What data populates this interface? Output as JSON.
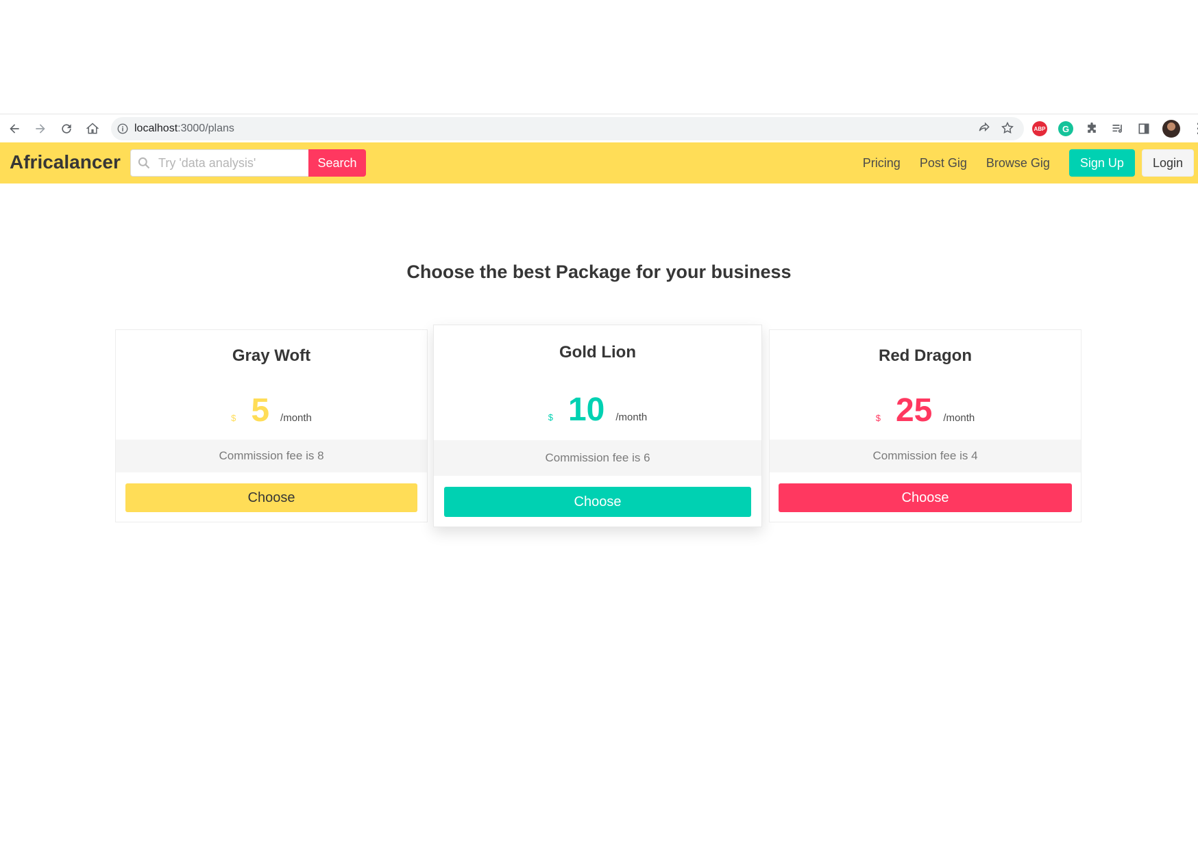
{
  "browser": {
    "url_host": "localhost",
    "url_path": ":3000/plans",
    "extensions": [
      "ABP",
      "G"
    ]
  },
  "navbar": {
    "brand": "Africalancer",
    "search_placeholder": "Try 'data analysis'",
    "search_button": "Search",
    "links": [
      "Pricing",
      "Post Gig",
      "Browse Gig"
    ],
    "signup": "Sign Up",
    "login": "Login"
  },
  "page": {
    "heading": "Choose the best Package for your business"
  },
  "plans": [
    {
      "name": "Gray Woft",
      "currency": "$",
      "amount": "5",
      "period": "/month",
      "commission": "Commission fee is 8",
      "button": "Choose",
      "color": "#ffdd57"
    },
    {
      "name": "Gold Lion",
      "currency": "$",
      "amount": "10",
      "period": "/month",
      "commission": "Commission fee is 6",
      "button": "Choose",
      "color": "#00d1b2"
    },
    {
      "name": "Red Dragon",
      "currency": "$",
      "amount": "25",
      "period": "/month",
      "commission": "Commission fee is 4",
      "button": "Choose",
      "color": "#ff3860"
    }
  ]
}
